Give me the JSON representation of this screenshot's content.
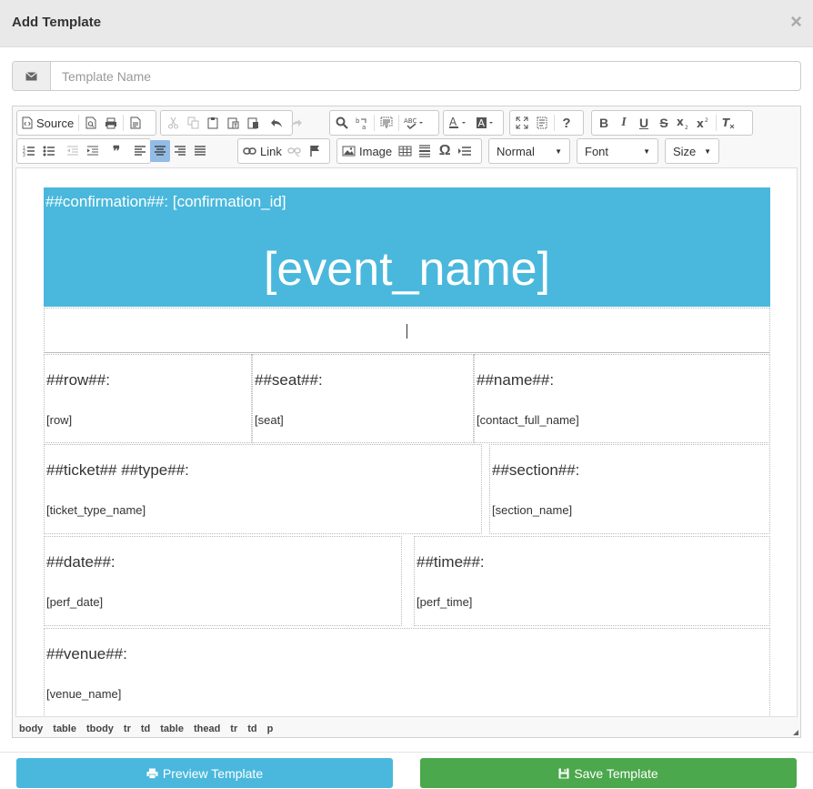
{
  "modal": {
    "title": "Add Template",
    "close": "×"
  },
  "name_field": {
    "placeholder": "Template Name",
    "value": ""
  },
  "toolbar": {
    "source_label": "Source",
    "link_label": "Link",
    "image_label": "Image",
    "format_combo": "Normal",
    "font_combo": "Font",
    "size_combo": "Size",
    "bold": "B",
    "italic": "I",
    "underline": "U",
    "strike": "S",
    "help": "?",
    "blockquote": "❞",
    "omega": "Ω"
  },
  "content": {
    "banner": {
      "confirmation": "##confirmation##: [confirmation_id]",
      "event_name": "[event_name]"
    },
    "row1": [
      {
        "head": "##row##:",
        "val": "[row]"
      },
      {
        "head": "##seat##:",
        "val": "[seat]"
      },
      {
        "head": "##name##:",
        "val": "[contact_full_name]"
      }
    ],
    "row2": [
      {
        "head": "##ticket## ##type##:",
        "val": "[ticket_type_name]"
      },
      {
        "head": "##section##:",
        "val": "[section_name]"
      }
    ],
    "row3": [
      {
        "head": "##date##:",
        "val": "[perf_date]"
      },
      {
        "head": "##time##:",
        "val": "[perf_time]"
      }
    ],
    "row4": [
      {
        "head": "##venue##:",
        "val": "[venue_name]"
      }
    ]
  },
  "element_path": [
    "body",
    "table",
    "tbody",
    "tr",
    "td",
    "table",
    "thead",
    "tr",
    "td",
    "p"
  ],
  "buttons": {
    "preview": "Preview Template",
    "save": "Save Template"
  },
  "colors": {
    "accent_blue": "#4ab8dc",
    "save_green": "#4ca84c",
    "active_button": "#92bce6"
  }
}
